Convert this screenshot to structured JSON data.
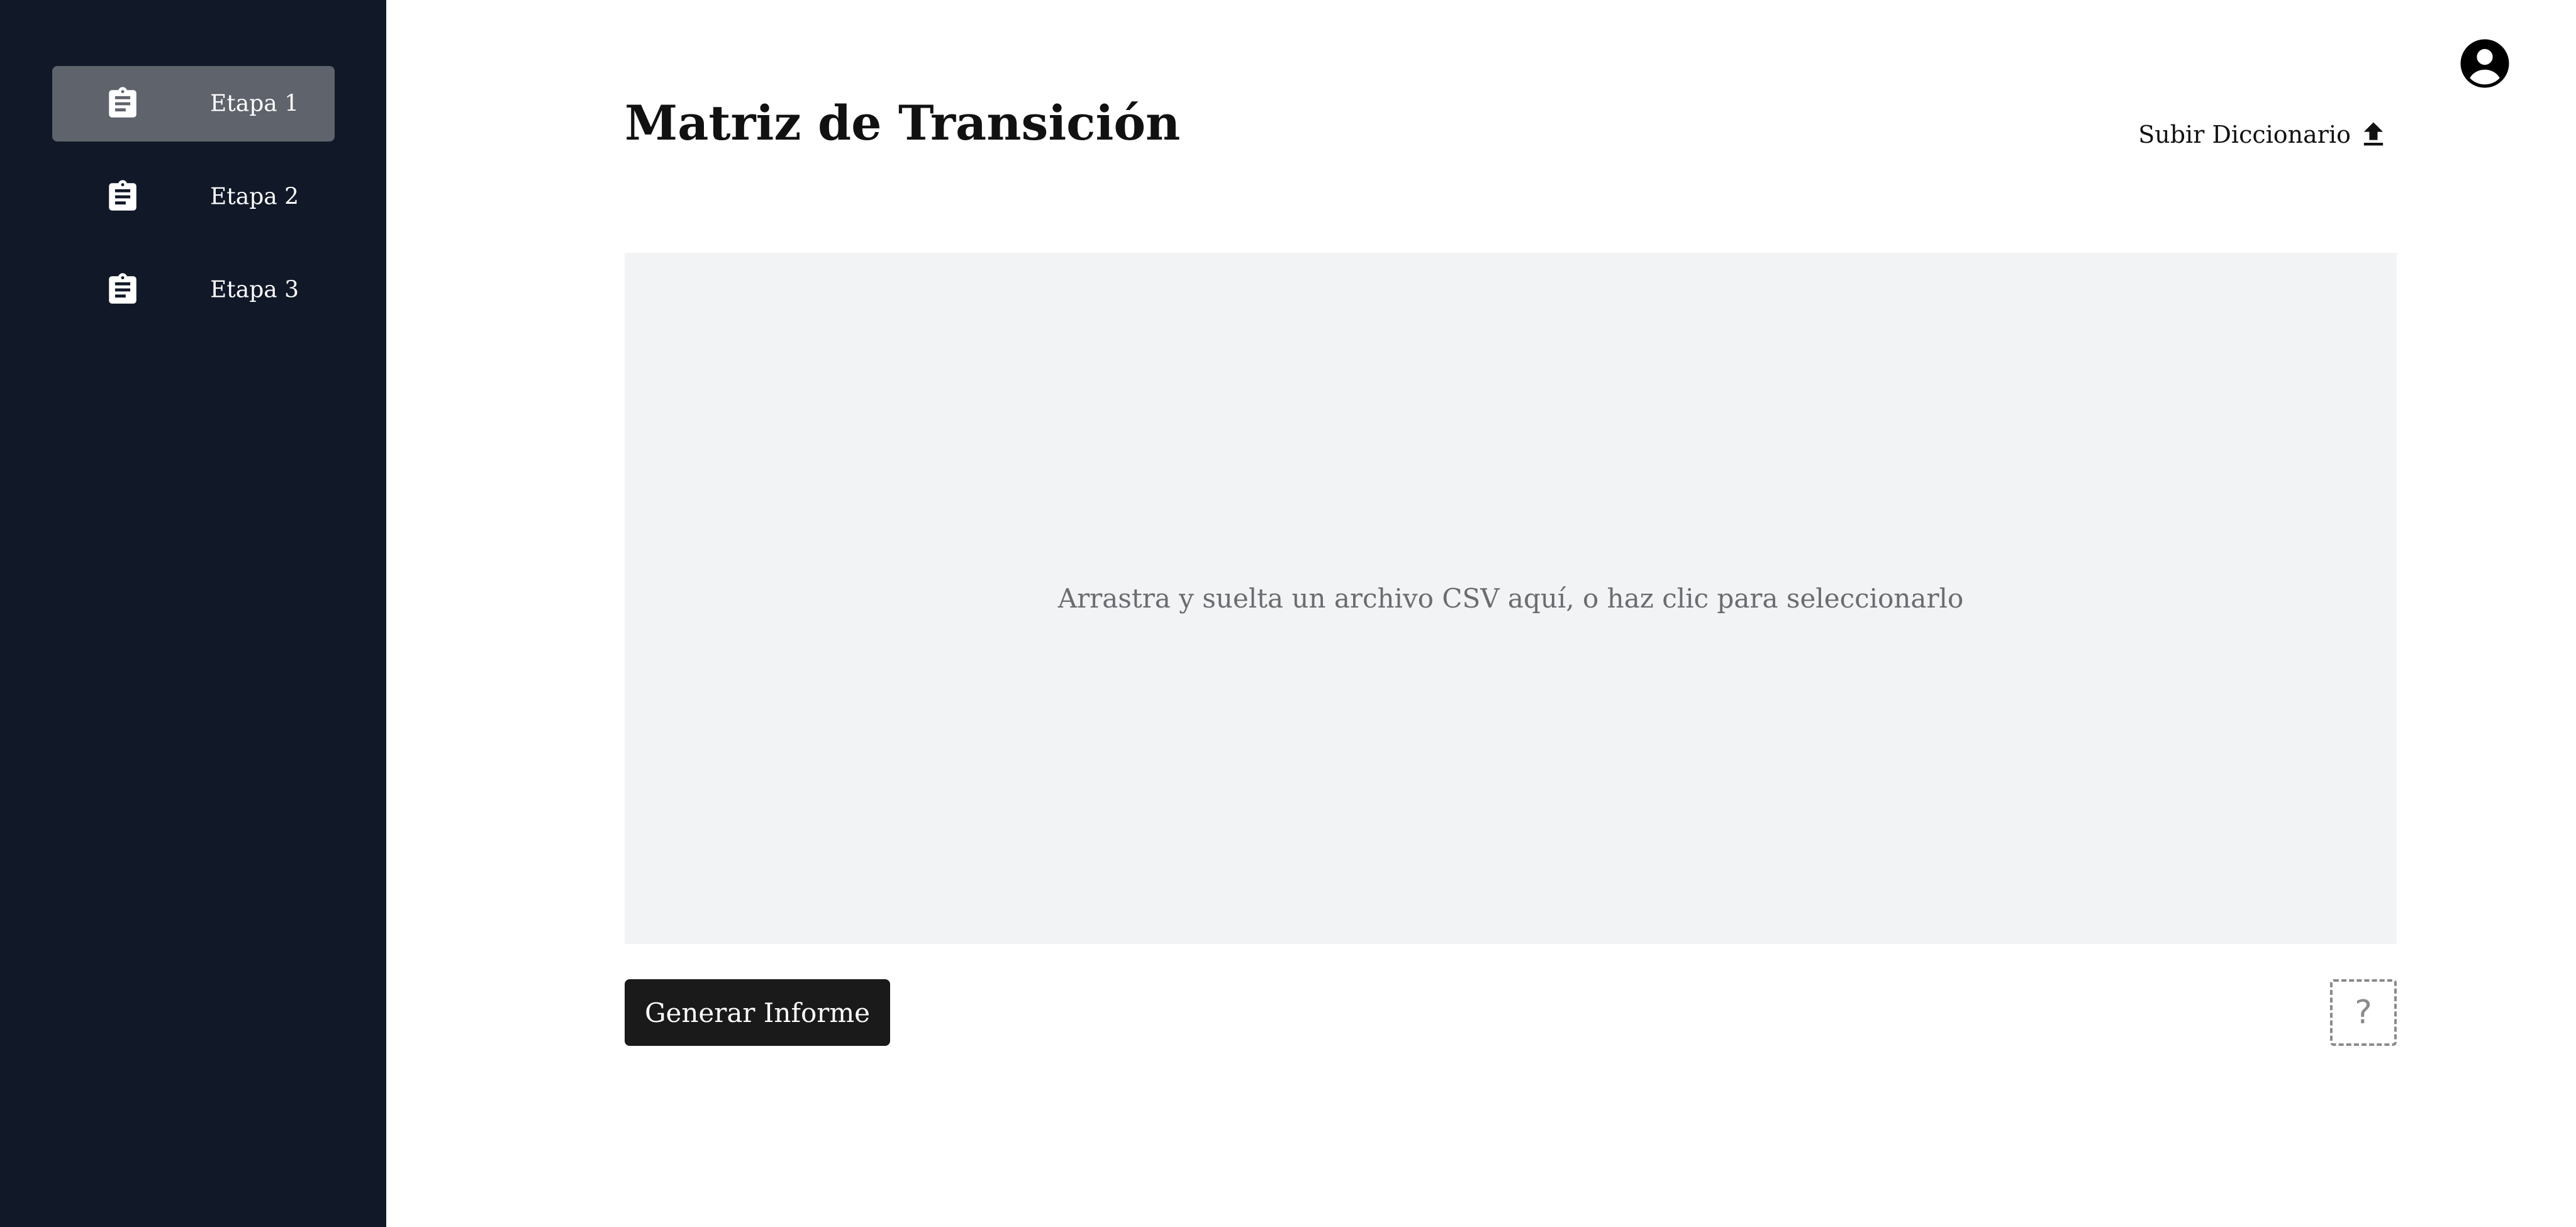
{
  "sidebar": {
    "items": [
      {
        "label": "Etapa 1",
        "icon": "clipboard-icon",
        "active": true
      },
      {
        "label": "Etapa 2",
        "icon": "clipboard-icon",
        "active": false
      },
      {
        "label": "Etapa 3",
        "icon": "clipboard-icon",
        "active": false
      }
    ]
  },
  "header": {
    "title": "Matriz de Transición",
    "upload_label": "Subir Diccionario",
    "upload_icon": "upload-icon",
    "avatar_icon": "user-circle-icon"
  },
  "main": {
    "dropzone_text": "Arrastra y suelta un archivo CSV aquí, o haz clic para seleccionarlo",
    "generate_label": "Generar Informe",
    "help_label": "?"
  },
  "colors": {
    "sidebar_bg": "#111827",
    "active_item_bg": "#5f636c",
    "dropzone_bg": "#f2f3f5",
    "button_bg": "#1a1a1a"
  }
}
